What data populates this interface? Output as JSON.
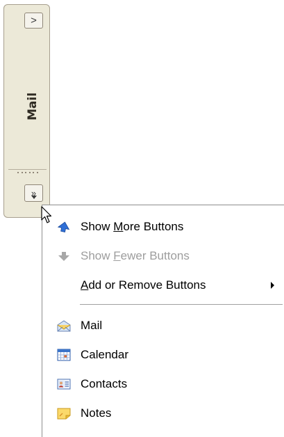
{
  "nav_pane": {
    "expand_glyph": ">",
    "title": "Mail",
    "configure_glyph": "»"
  },
  "context_menu": {
    "items": [
      {
        "pre": "Show ",
        "key": "M",
        "post": "ore Buttons",
        "icon": "arrow-up-icon",
        "enabled": true
      },
      {
        "pre": "Show ",
        "key": "F",
        "post": "ewer Buttons",
        "icon": "arrow-down-icon",
        "enabled": false
      },
      {
        "pre": "",
        "key": "A",
        "post": "dd or Remove Buttons",
        "icon": "",
        "enabled": true,
        "submenu": true
      }
    ],
    "nav_items": [
      {
        "label": "Mail",
        "icon": "mail-icon"
      },
      {
        "label": "Calendar",
        "icon": "calendar-icon"
      },
      {
        "label": "Contacts",
        "icon": "contacts-icon"
      },
      {
        "label": "Notes",
        "icon": "notes-icon"
      }
    ]
  },
  "colors": {
    "pane_background": "#ece9d8",
    "menu_border": "#8e8e8e",
    "disabled_text": "#9d9d9d"
  }
}
